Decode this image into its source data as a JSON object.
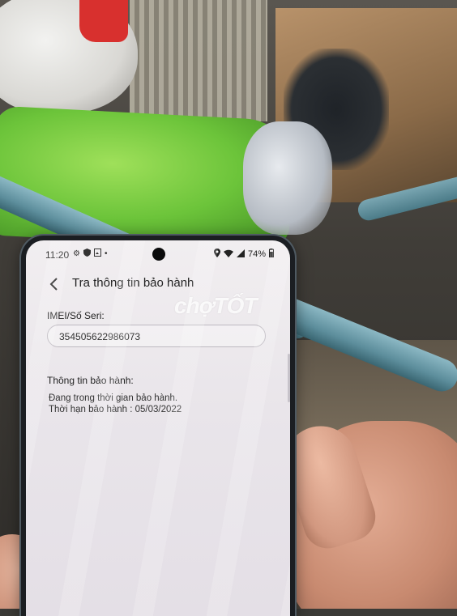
{
  "status_bar": {
    "time": "11:20",
    "battery": "74%",
    "icons": [
      "gear-icon",
      "shield-icon",
      "image-icon",
      "dot-icon",
      "location-icon",
      "wifi-icon",
      "signal-icon",
      "battery-icon"
    ]
  },
  "header": {
    "title": "Tra thông tin bảo hành"
  },
  "imei": {
    "label": "IMEI/Số Seri:",
    "value": "354505622986073"
  },
  "warranty": {
    "heading": "Thông tin bảo hành:",
    "status": "Đang trong thời gian bảo hành.",
    "expiry": "Thời hạn bảo hành : 05/03/2022"
  },
  "watermark": {
    "text": "chợTỐT"
  }
}
